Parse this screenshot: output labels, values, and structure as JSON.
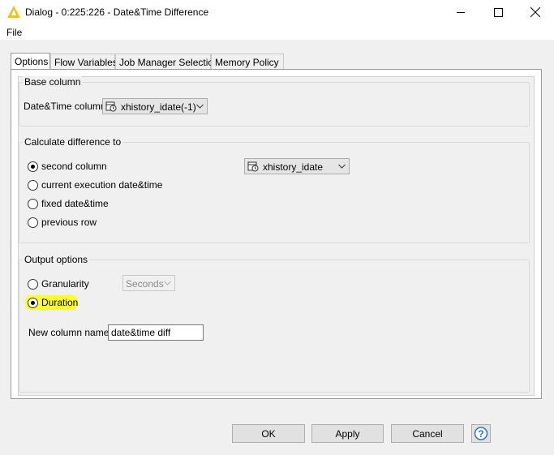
{
  "window": {
    "title": "Dialog - 0:225:226 - Date&Time Difference"
  },
  "menu": {
    "file": "File"
  },
  "tabs": [
    {
      "label": "Options",
      "active": true
    },
    {
      "label": "Flow Variables",
      "active": false
    },
    {
      "label": "Job Manager Selection",
      "active": false
    },
    {
      "label": "Memory Policy",
      "active": false
    }
  ],
  "base_column": {
    "title": "Base column",
    "label": "Date&Time column",
    "value": "xhistory_idate(-1)"
  },
  "calc_diff": {
    "title": "Calculate difference to",
    "options": [
      {
        "label": "second column",
        "checked": true
      },
      {
        "label": "current execution date&time",
        "checked": false
      },
      {
        "label": "fixed date&time",
        "checked": false
      },
      {
        "label": "previous row",
        "checked": false
      }
    ],
    "second_column_value": "xhistory_idate"
  },
  "output": {
    "title": "Output options",
    "granularity_label": "Granularity",
    "granularity_checked": false,
    "granularity_value": "Seconds",
    "duration_label": "Duration",
    "duration_checked": true,
    "new_col_label": "New column name:",
    "new_col_value": "date&time diff"
  },
  "buttons": {
    "ok": "OK",
    "apply": "Apply",
    "cancel": "Cancel",
    "help": "?"
  },
  "colors": {
    "highlight": "#ffff2b",
    "help_blue": "#2f74c0",
    "warning_yellow": "#f2c218"
  }
}
